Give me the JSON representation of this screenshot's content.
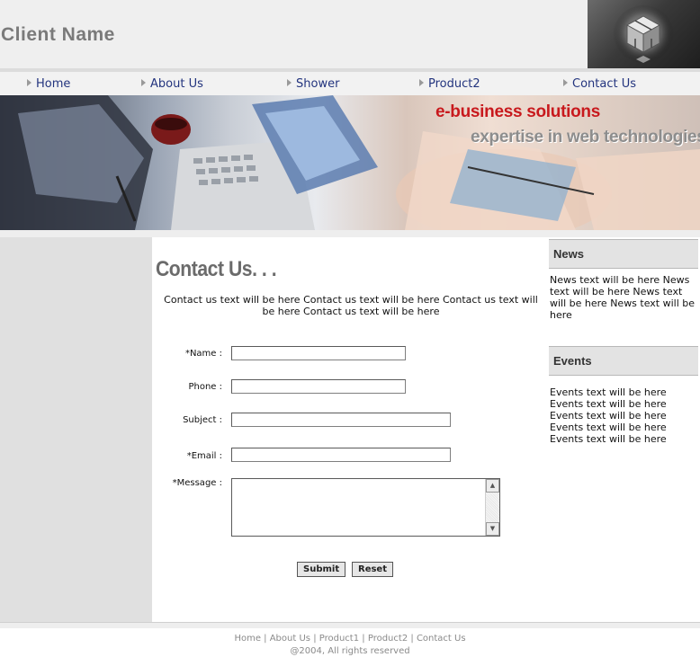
{
  "header": {
    "client_name": "Client Name"
  },
  "nav": {
    "items": [
      "Home",
      "About Us",
      "Shower",
      "Product2",
      "Contact Us"
    ]
  },
  "banner": {
    "line1": "e-business solutions",
    "line2": "expertise in web technologies"
  },
  "main": {
    "title": "Contact Us. . .",
    "intro": "Contact us text will be here Contact us text will be here Contact us text will be here Contact us text will be here",
    "form": {
      "name_label": "*Name :",
      "phone_label": "Phone :",
      "subject_label": "Subject :",
      "email_label": "*Email :",
      "message_label": "*Message :",
      "submit_label": "Submit",
      "reset_label": "Reset"
    }
  },
  "sidebar": {
    "news_title": "News",
    "news_text": "News text will be here News text will be here News text will be here News text will be here",
    "events_title": "Events",
    "events_lines": [
      "Events text will be here",
      "Events text will be here",
      "Events text will be here",
      "Events text will be here",
      "Events text will be here"
    ]
  },
  "footer": {
    "links": [
      "Home",
      "About Us",
      "Product1",
      "Product2",
      "Contact Us"
    ],
    "separator": "|",
    "copyright": "@2004, All rights reserved"
  },
  "colors": {
    "nav_link": "#23347e",
    "banner_accent": "#c8191d",
    "title_gray": "#6b6b6b"
  }
}
